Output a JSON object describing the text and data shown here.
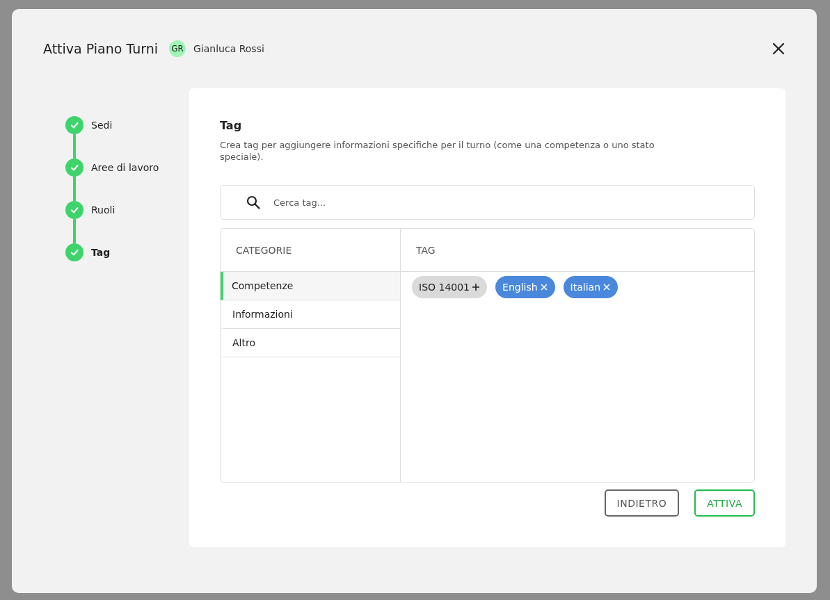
{
  "dialog": {
    "title": "Attiva Piano Turni",
    "user": {
      "initials": "GR",
      "name": "Gianluca Rossi"
    }
  },
  "steps": [
    {
      "label": "Sedi",
      "done": true,
      "selected": false
    },
    {
      "label": "Aree di lavoro",
      "done": true,
      "selected": false
    },
    {
      "label": "Ruoli",
      "done": true,
      "selected": false
    },
    {
      "label": "Tag",
      "done": true,
      "selected": true
    }
  ],
  "section": {
    "title": "Tag",
    "description": "Crea tag per aggiungere informazioni specifiche per il turno (come una competenza o uno stato speciale)."
  },
  "search": {
    "placeholder": "Cerca tag..."
  },
  "table": {
    "columns": [
      "CATEGORIE",
      "TAG"
    ],
    "categories": [
      {
        "label": "Competenze",
        "selected": true
      },
      {
        "label": "Informazioni",
        "selected": false
      },
      {
        "label": "Altro",
        "selected": false
      }
    ],
    "tags": [
      {
        "label": "ISO 14001",
        "kind": "available"
      },
      {
        "label": "English",
        "kind": "added"
      },
      {
        "label": "Italian",
        "kind": "added"
      }
    ]
  },
  "buttons": [
    {
      "label": "INDIETRO",
      "kind": "secondary"
    },
    {
      "label": "ATTIVA",
      "kind": "primary"
    }
  ]
}
